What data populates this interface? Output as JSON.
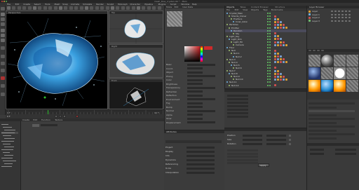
{
  "titlebar": {
    "title": "mesh_blue_crystal.c4d * - Main"
  },
  "menus": [
    "File",
    "Edit",
    "Create",
    "Select",
    "Tools",
    "Mesh",
    "Snap",
    "Animate",
    "Simulate",
    "Render",
    "Sculpt",
    "MoGraph",
    "Character",
    "Pipeline",
    "Plugins",
    "Script",
    "Window",
    "Help"
  ],
  "viewports": {
    "perspective": "Perspective",
    "top": "Top",
    "right": "Right",
    "front": "Front"
  },
  "object_manager": {
    "tabs": [
      "Objects",
      "Takes",
      "Content Browser",
      "Structure"
    ],
    "menu": [
      "File",
      "Edit",
      "View",
      "Objects",
      "Tags",
      "Bookmarks"
    ],
    "items": [
      "Crystal_Main",
      "Shards_Cloner",
      "Fracture",
      "Inner_Glow",
      "Particles",
      "Emitter",
      "Random",
      "Sky",
      "Light_Key",
      "Light_Rim",
      "Light_Fill",
      "Camera",
      "Floor",
      "Null",
      "Null.1",
      "Null.2",
      "Null.3",
      "Null.4",
      "Null.5",
      "Null.6",
      "Null.7",
      "Null.8",
      "Null.9",
      "Null.10",
      "Null.11",
      "Null.12"
    ]
  },
  "layer_panel": {
    "title": "Layer Browser",
    "items": [
      "Layer",
      "Layer.1",
      "Layer.2",
      "Layer.3"
    ]
  },
  "material_manager": {
    "menu": [
      "Create",
      "Edit",
      "Function",
      "Texture"
    ]
  },
  "attribute_manager": {
    "menu": [
      "Mode",
      "Edit",
      "User Data"
    ],
    "fields": [
      "Basic",
      "Coord.",
      "Object",
      "Phong",
      "Color",
      "Brightness",
      "Transparency",
      "Refraction",
      "Reflection",
      "Environment",
      "Fog",
      "Bump",
      "Normal",
      "Alpha",
      "Glow",
      "Displacement"
    ]
  },
  "timeline": {
    "start": "0 F",
    "end": "90 F",
    "current": "0 F"
  },
  "coordinates": {
    "labels": [
      "Position",
      "Size",
      "Rotation"
    ],
    "x": "0 cm",
    "y": "0 cm",
    "z": "0 cm",
    "apply": "Apply"
  },
  "lower_panel": {
    "title": "Attributes",
    "rows": [
      "Project",
      "Display",
      "Info",
      "Dynamics",
      "Referencing",
      "To Do",
      "Interpolation"
    ]
  },
  "colors": {
    "accent": "#f0a030",
    "viewport_bg": "#000000",
    "crystal": "#3aa0e0"
  }
}
